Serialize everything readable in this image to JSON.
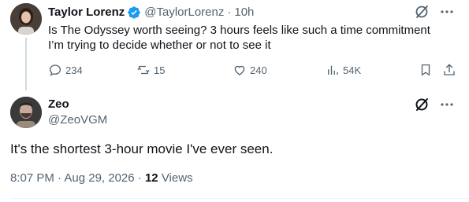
{
  "tweet": {
    "author_name": "Taylor Lorenz",
    "handle": "@TaylorLorenz",
    "separator": "·",
    "time": "10h",
    "text_line1": "Is The Odyssey worth seeing? 3 hours feels like such a time commitment",
    "text_line2": "I’m trying to decide whether or not to see it",
    "replies": "234",
    "retweets": "15",
    "likes": "240",
    "views": "54K",
    "verified": true
  },
  "reply": {
    "author_name": "Zeo",
    "handle": "@ZeoVGM",
    "text": "It's the shortest 3-hour movie I've ever seen.",
    "timestamp": "8:07 PM · Aug 29, 2026",
    "separator": "·",
    "views_count": "12",
    "views_label": "Views"
  },
  "colors": {
    "verified_blue": "#1d9bf0",
    "text_primary": "#0f1419",
    "text_secondary": "#536471"
  },
  "icons": [
    "verified-badge-icon",
    "grok-icon",
    "more-icon",
    "reply-icon",
    "retweet-icon",
    "like-icon",
    "views-icon",
    "bookmark-icon",
    "share-icon"
  ]
}
